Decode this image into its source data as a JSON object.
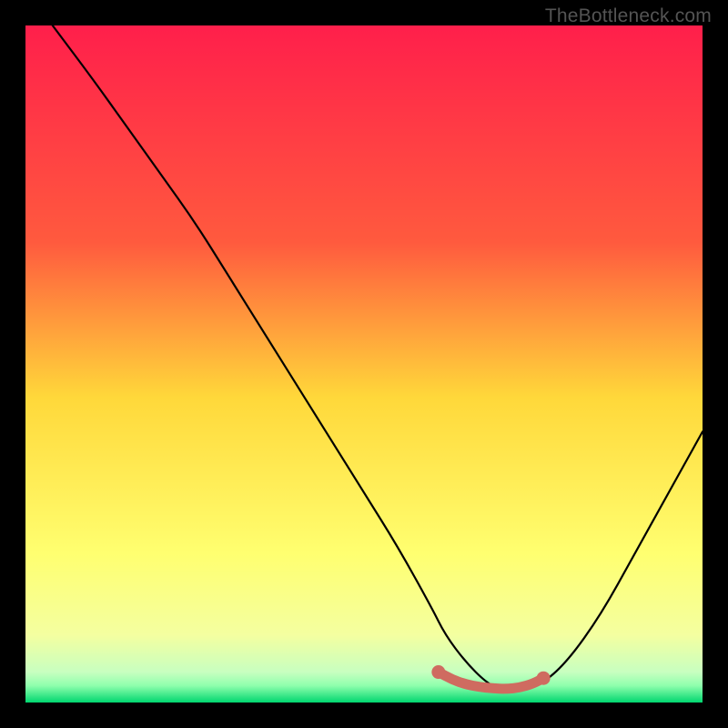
{
  "watermark": "TheBottleneck.com",
  "chart_data": {
    "type": "line",
    "title": "",
    "xlabel": "",
    "ylabel": "",
    "xlim": [
      0,
      100
    ],
    "ylim": [
      0,
      100
    ],
    "gradient_colors": {
      "top": "#ff1f4b",
      "mid1": "#ff7a3c",
      "mid2": "#ffd83a",
      "mid3": "#f8ff55",
      "mid4": "#d9ffb0",
      "bottom": "#00d66f"
    },
    "series": [
      {
        "name": "bottleneck-curve",
        "color": "#000000",
        "x": [
          4,
          10,
          15,
          20,
          25,
          30,
          35,
          40,
          45,
          50,
          55,
          60,
          62,
          65,
          68,
          70,
          73,
          76,
          80,
          85,
          90,
          95,
          100
        ],
        "y": [
          100,
          92,
          85,
          78,
          71,
          63,
          55,
          47,
          39,
          31,
          23,
          14,
          10,
          6,
          3,
          2,
          2,
          2.5,
          6,
          13,
          22,
          31,
          40
        ]
      },
      {
        "name": "optimal-highlight",
        "color": "#cf6b60",
        "x": [
          61,
          63,
          65,
          67,
          69,
          71,
          73,
          75,
          76.5
        ],
        "y": [
          4.5,
          3.4,
          2.7,
          2.3,
          2.1,
          2.0,
          2.2,
          2.8,
          3.6
        ]
      }
    ],
    "highlight_endpoints": [
      {
        "x": 61,
        "y": 4.5
      },
      {
        "x": 76.5,
        "y": 3.6
      }
    ]
  }
}
